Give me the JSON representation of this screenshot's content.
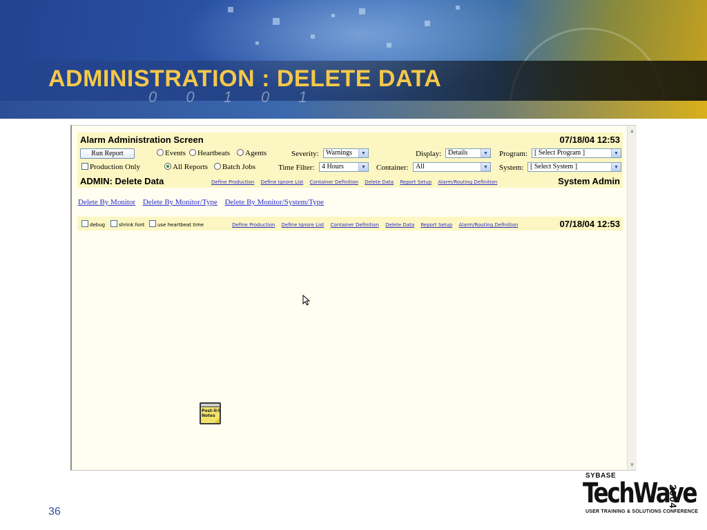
{
  "slide": {
    "title": "ADMINISTRATION : DELETE DATA",
    "page_number": "36",
    "banner_digits": "0 0 1 0 1",
    "logo": {
      "brand": "SYBASE",
      "name": "TechWave",
      "year": "2004",
      "tagline": "USER TRAINING & SOLUTIONS CONFERENCE"
    }
  },
  "app": {
    "screen_title": "Alarm Administration Screen",
    "timestamp": "07/18/04 12:53",
    "run_report_label": "Run Report",
    "view_radios": [
      {
        "label": "Events",
        "checked": false
      },
      {
        "label": "Heartbeats",
        "checked": false
      },
      {
        "label": "Agents",
        "checked": false
      }
    ],
    "production_only_label": "Production Only",
    "report_radios": [
      {
        "label": "All Reports",
        "checked": true
      },
      {
        "label": "Batch Jobs",
        "checked": false
      }
    ],
    "filters": {
      "severity": {
        "label": "Severity:",
        "value": "Warnings"
      },
      "display": {
        "label": "Display:",
        "value": "Details"
      },
      "program": {
        "label": "Program:",
        "value": "[ Select Program ]"
      },
      "time_filter": {
        "label": "Time Filter:",
        "value": "4 Hours"
      },
      "container": {
        "label": "Container:",
        "value": "All"
      },
      "system": {
        "label": "System:",
        "value": "[ Select System ]"
      }
    },
    "section_title": "ADMIN: Delete Data",
    "section_role": "System Admin",
    "nav_links": [
      "Define Production",
      "Define Ignore List",
      "Container Definition",
      "Delete Data",
      "Report Setup",
      "Alarm/Routing Definition"
    ],
    "delete_links": [
      "Delete By Monitor",
      "Delete By Monitor/Type",
      "Delete By Monitor/System/Type"
    ],
    "footer_options": [
      "debug",
      "shrink font",
      "use heartbeat time"
    ],
    "footer_timestamp": "07/18/04 12:53",
    "postit": {
      "line1": "Post-it®",
      "line2": "Notes"
    }
  },
  "colors": {
    "title": "#f4c84a",
    "panel_background": "#fcf6c2",
    "link": "#2a2acc",
    "page_number": "#2f4f9a"
  },
  "icons": [
    "mouse-pointer-icon",
    "post-it-notes-icon",
    "dropdown-arrow-icon",
    "scroll-up-icon",
    "scroll-down-icon"
  ]
}
